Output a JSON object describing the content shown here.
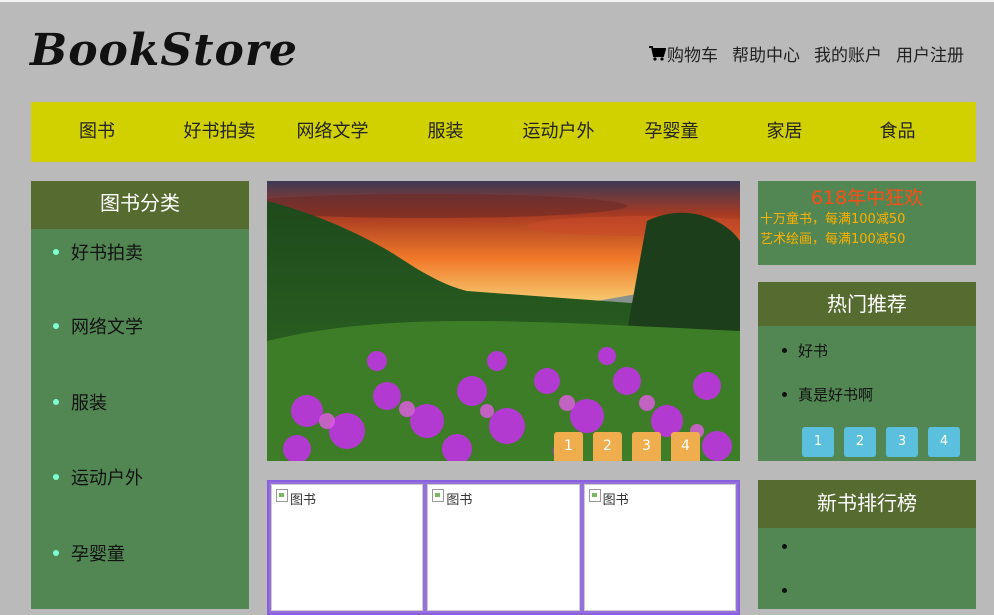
{
  "header": {
    "logo": "BookStore",
    "links": [
      {
        "label": "购物车"
      },
      {
        "label": "帮助中心"
      },
      {
        "label": "我的账户"
      },
      {
        "label": "用户注册"
      }
    ]
  },
  "nav": [
    "图书",
    "好书拍卖",
    "网络文学",
    "服装",
    "运动户外",
    "孕婴童",
    "家居",
    "食品"
  ],
  "categories": {
    "title": "图书分类",
    "items": [
      "好书拍卖",
      "网络文学",
      "服装",
      "运动户外",
      "孕婴童"
    ]
  },
  "banner": {
    "alt": "图书",
    "dots": [
      "1",
      "2",
      "3",
      "4"
    ]
  },
  "books": {
    "cards": [
      "图书",
      "图书",
      "图书"
    ]
  },
  "promo": {
    "title": "618年中狂欢",
    "lines": [
      "十万童书，每满100减50",
      "艺术绘画，每满100减50"
    ]
  },
  "hot": {
    "title": "热门推荐",
    "items": [
      "好书",
      "真是好书啊"
    ],
    "pages": [
      "1",
      "2",
      "3",
      "4"
    ]
  },
  "rank": {
    "title": "新书排行榜",
    "items": [
      "",
      ""
    ]
  },
  "colors": {
    "page_bg": "#bababa",
    "nav_bg": "#d1d100",
    "panel_bg": "#528753",
    "panel_head": "#556b2f",
    "banner_dot": "#f0ad4e",
    "pager": "#5bc0de",
    "promo_title": "#ff4c14",
    "promo_text": "#ffb000",
    "books_border": "#9370db"
  }
}
